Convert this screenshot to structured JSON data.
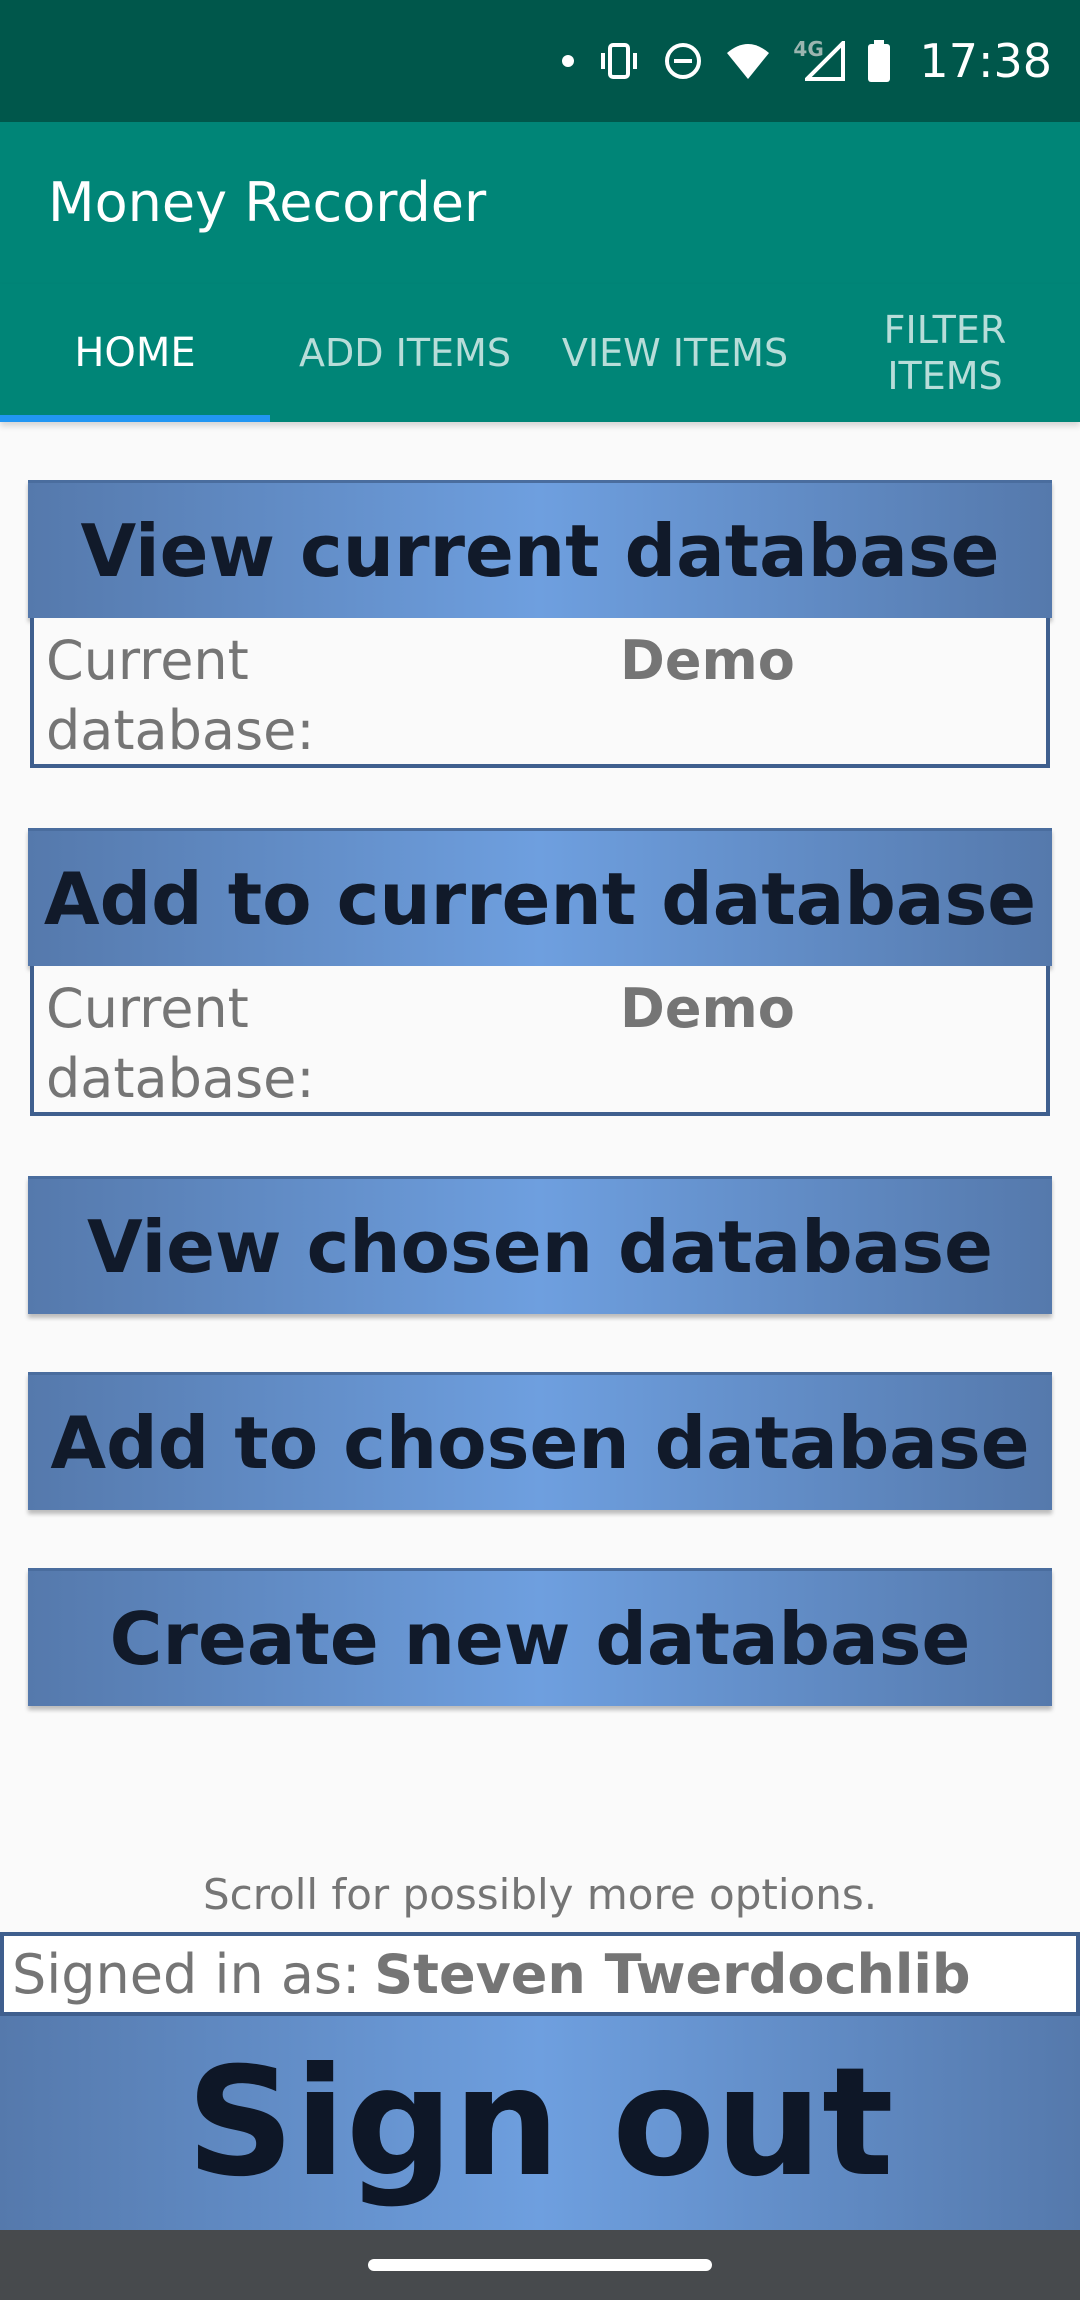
{
  "status_bar": {
    "time": "17:38",
    "icons": [
      "notification-dot-icon",
      "vibrate-icon",
      "do-not-disturb-icon",
      "wifi-icon",
      "signal-4g-icon",
      "battery-icon"
    ],
    "network_label": "4G"
  },
  "app_bar": {
    "title": "Money Recorder"
  },
  "tabs": [
    {
      "label": "HOME",
      "active": true
    },
    {
      "label": "ADD ITEMS",
      "active": false
    },
    {
      "label": "VIEW ITEMS",
      "active": false
    },
    {
      "label": "FILTER ITEMS",
      "active": false
    }
  ],
  "main": {
    "view_current_button": "View current database",
    "view_current_info": {
      "label": "Current database:",
      "value": "Demo"
    },
    "add_current_button": "Add to current database",
    "add_current_info": {
      "label": "Current database:",
      "value": "Demo"
    },
    "view_chosen_button": "View chosen database",
    "add_chosen_button": "Add to chosen database",
    "create_button": "Create new database",
    "scroll_hint": "Scroll for possibly more options."
  },
  "footer": {
    "signed_in_label": "Signed in as:",
    "signed_in_name": "Steven Twerdochlib",
    "sign_out_button": "Sign out"
  },
  "colors": {
    "status_bar": "#00574b",
    "app_bar": "#008577",
    "tab_indicator": "#2196f3",
    "button_edge": "#5579ac",
    "button_center": "#6e9fdf",
    "box_border": "#3f5f8e"
  }
}
